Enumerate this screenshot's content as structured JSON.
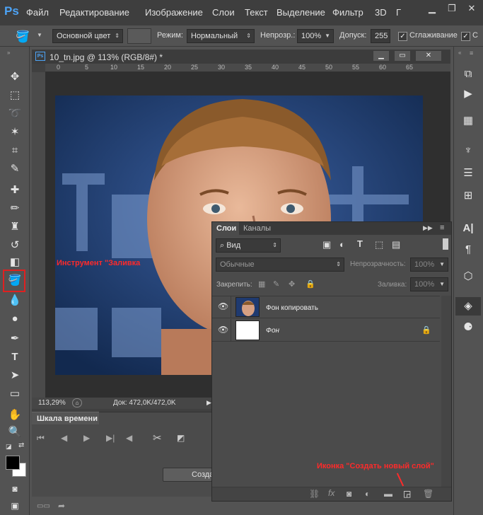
{
  "app": {
    "logo": "Ps"
  },
  "menu": [
    "Файл",
    "Редактирование",
    "Изображение",
    "Слои",
    "Текст",
    "Выделение",
    "Фильтр",
    "3D",
    "Г"
  ],
  "options_bar": {
    "fill_source": "Основной цвет",
    "mode_label": "Режим:",
    "mode_value": "Нормальный",
    "opacity_label": "Непрозр.:",
    "opacity_value": "100%",
    "tolerance_label": "Допуск:",
    "tolerance_value": "255",
    "antialias_label": "Сглаживание",
    "antialias_checked": true,
    "contiguous_label": "С"
  },
  "document": {
    "tab_title": "10_tn.jpg @ 113% (RGB/8#) *",
    "ruler_marks": [
      "0",
      "5",
      "10",
      "15",
      "20",
      "25",
      "30",
      "35",
      "40",
      "45",
      "50",
      "55",
      "60",
      "65"
    ],
    "zoom": "113,29%",
    "doc_size": "Док: 472,0K/472,0K"
  },
  "timeline": {
    "tab": "Шкала времени",
    "create_button": "Созда"
  },
  "layers_panel": {
    "tab_layers": "Слои",
    "tab_channels": "Каналы",
    "filter_kind": "Вид",
    "blend_mode": "Обычные",
    "opacity_label": "Непрозрачность:",
    "opacity_value": "100%",
    "lock_label": "Закрепить:",
    "fill_label": "Заливка:",
    "fill_value": "100%",
    "layers": [
      {
        "name": "Фон копировать",
        "italic": false
      },
      {
        "name": "Фон",
        "italic": true
      }
    ]
  },
  "annotations": {
    "fill_tool": "Инструмент \"Заливка",
    "new_layer": "Иконка \"Создать новый слой\""
  },
  "colors": {
    "accent_red": "#e02020",
    "ps_blue": "#4da3f5",
    "panel_bg": "#535353"
  }
}
